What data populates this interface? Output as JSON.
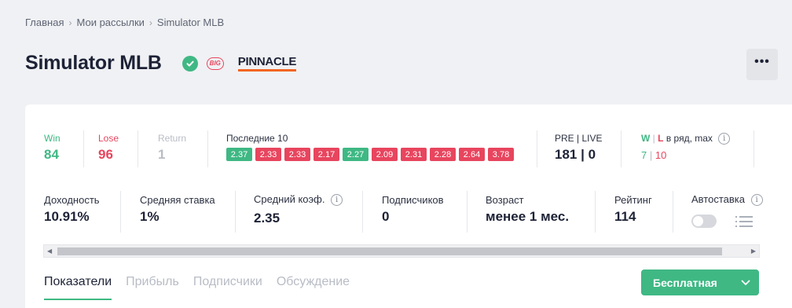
{
  "breadcrumb": {
    "items": [
      "Главная",
      "Мои рассылки",
      "Simulator MLB"
    ]
  },
  "header": {
    "title": "Simulator MLB",
    "big_badge": "BIG",
    "bookmaker": "PINNACLE"
  },
  "stats": {
    "win": {
      "label": "Win",
      "value": "84"
    },
    "lose": {
      "label": "Lose",
      "value": "96"
    },
    "return": {
      "label": "Return",
      "value": "1"
    },
    "last10": {
      "label": "Последние 10",
      "items": [
        {
          "value": "2.37",
          "result": "win"
        },
        {
          "value": "2.33",
          "result": "lose"
        },
        {
          "value": "2.33",
          "result": "lose"
        },
        {
          "value": "2.17",
          "result": "lose"
        },
        {
          "value": "2.27",
          "result": "win"
        },
        {
          "value": "2.09",
          "result": "lose"
        },
        {
          "value": "2.31",
          "result": "lose"
        },
        {
          "value": "2.28",
          "result": "lose"
        },
        {
          "value": "2.64",
          "result": "lose"
        },
        {
          "value": "3.78",
          "result": "lose"
        }
      ]
    },
    "pre_live": {
      "label": "PRE | LIVE",
      "value": "181 | 0"
    },
    "streak_max": {
      "w": "W",
      "sep": "|",
      "l": "L",
      "label_rest": "в ряд, max",
      "w_value": "7",
      "value_sep": "|",
      "l_value": "10"
    }
  },
  "metrics": {
    "yield": {
      "label": "Доходность",
      "value": "10.91%"
    },
    "avg_stake": {
      "label": "Средняя ставка",
      "value": "1%"
    },
    "avg_odds": {
      "label": "Средний коэф.",
      "value": "2.35"
    },
    "subscribers": {
      "label": "Подписчиков",
      "value": "0"
    },
    "age": {
      "label": "Возраст",
      "value": "менее 1 мес."
    },
    "rating": {
      "label": "Рейтинг",
      "value": "114"
    },
    "autobet": {
      "label": "Автоставка"
    }
  },
  "tabs": [
    {
      "label": "Показатели",
      "active": true
    },
    {
      "label": "Прибыль",
      "active": false
    },
    {
      "label": "Подписчики",
      "active": false
    },
    {
      "label": "Обсуждение",
      "active": false
    }
  ],
  "cta": {
    "label": "Бесплатная"
  },
  "colors": {
    "win": "#3fb884",
    "lose": "#e8455e",
    "muted": "#b8bcc5",
    "text": "#1d2236",
    "bookmaker_accent": "#f26522"
  },
  "icons": {
    "verified": "check-circle-icon",
    "info": "info-icon",
    "more": "more-horizontal-icon",
    "list": "list-icon",
    "chevron": "chevron-down-icon"
  }
}
